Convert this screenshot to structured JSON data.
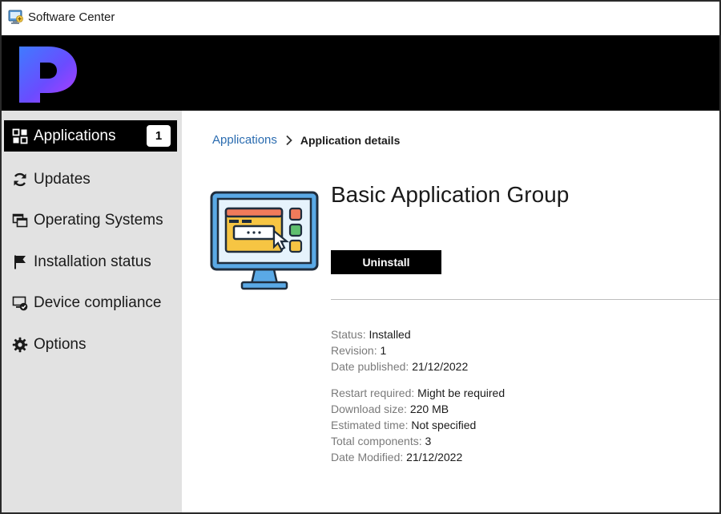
{
  "window": {
    "title": "Software Center"
  },
  "sidebar": {
    "items": [
      {
        "label": "Applications",
        "icon": "applications-icon",
        "badge": "1",
        "active": true
      },
      {
        "label": "Updates",
        "icon": "updates-icon"
      },
      {
        "label": "Operating Systems",
        "icon": "operating-systems-icon"
      },
      {
        "label": "Installation status",
        "icon": "flag-icon"
      },
      {
        "label": "Device compliance",
        "icon": "device-compliance-icon"
      },
      {
        "label": "Options",
        "icon": "gear-icon"
      }
    ]
  },
  "breadcrumb": {
    "link": "Applications",
    "current": "Application details"
  },
  "app": {
    "title": "Basic Application Group",
    "action_label": "Uninstall"
  },
  "details": {
    "status": {
      "key": "Status:",
      "value": "Installed"
    },
    "revision": {
      "key": "Revision:",
      "value": "1"
    },
    "date_published": {
      "key": "Date published:",
      "value": "21/12/2022"
    },
    "restart_required": {
      "key": "Restart required:",
      "value": "Might be required"
    },
    "download_size": {
      "key": "Download size:",
      "value": "220 MB"
    },
    "estimated_time": {
      "key": "Estimated time:",
      "value": "Not specified"
    },
    "total_components": {
      "key": "Total components:",
      "value": "3"
    },
    "date_modified": {
      "key": "Date Modified:",
      "value": "21/12/2022"
    }
  },
  "colors": {
    "banner": "#000000",
    "sidebar": "#e2e2e2",
    "active_nav": "#000000",
    "link": "#2b6cb0",
    "button": "#000000"
  }
}
